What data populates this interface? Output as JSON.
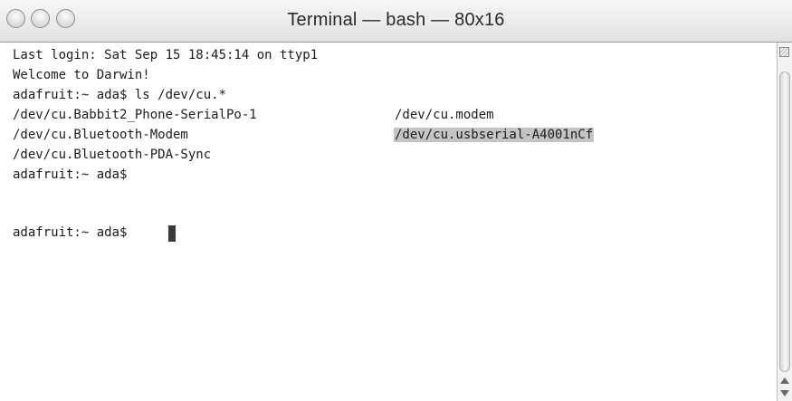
{
  "window": {
    "title": "Terminal — bash — 80x16"
  },
  "terminal": {
    "line1": "Last login: Sat Sep 15 18:45:14 on ttyp1",
    "line2": "Welcome to Darwin!",
    "line3": "adafruit:~ ada$ ls /dev/cu.*",
    "line4_col1": "/dev/cu.Babbit2_Phone-SerialPo-1",
    "line4_col2": "/dev/cu.modem",
    "line5_col1": "/dev/cu.Bluetooth-Modem",
    "line5_col2_selected": "/dev/cu.usbserial-A4001nCf",
    "line6": "/dev/cu.Bluetooth-PDA-Sync",
    "line7": "adafruit:~ ada$",
    "line9": "adafruit:~ ada$"
  },
  "colors": {
    "selection": "#c4c4c4",
    "text": "#1c1c1c",
    "background": "#ffffff"
  }
}
